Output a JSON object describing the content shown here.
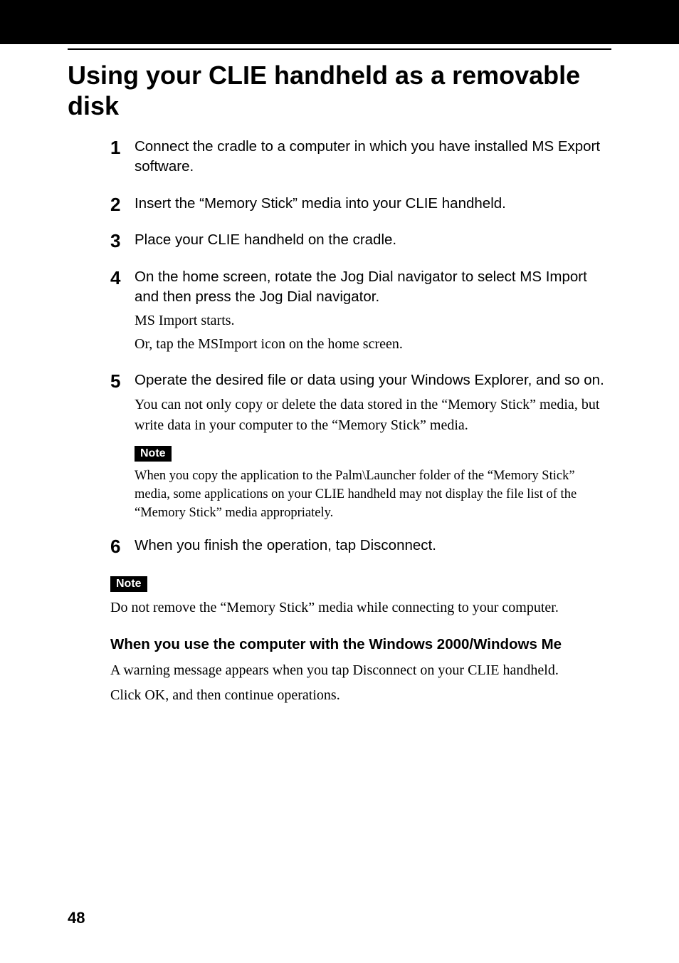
{
  "title": "Using your CLIE handheld as a removable disk",
  "steps": [
    {
      "num": "1",
      "instruction": "Connect the cradle to a computer in which you have installed MS Export software."
    },
    {
      "num": "2",
      "instruction": "Insert the “Memory Stick” media into your CLIE handheld."
    },
    {
      "num": "3",
      "instruction": "Place your CLIE handheld on the cradle."
    },
    {
      "num": "4",
      "instruction": "On the home screen, rotate the Jog Dial navigator to select MS Import and then press the Jog Dial navigator.",
      "subs": [
        "MS Import starts.",
        "Or, tap the MSImport icon on the home screen."
      ]
    },
    {
      "num": "5",
      "instruction": "Operate the desired file or data using your Windows Explorer, and so on.",
      "subs": [
        "You can not only copy or delete the data stored in the “Memory Stick” media, but write data in your computer to the “Memory Stick” media."
      ],
      "note": {
        "label": "Note",
        "text": "When you copy the application to the Palm\\Launcher folder of the “Memory Stick” media, some applications on your CLIE handheld may not display the file list of the “Memory Stick” media appropriately."
      }
    },
    {
      "num": "6",
      "instruction": "When you finish the operation, tap Disconnect."
    }
  ],
  "outer_note": {
    "label": "Note",
    "text": "Do not remove the “Memory Stick” media while connecting to your computer."
  },
  "sub_heading": "When you use the computer with the Windows 2000/Windows Me",
  "sub_paras": [
    "A warning message appears when you tap Disconnect on your CLIE handheld.",
    "Click OK, and then continue operations."
  ],
  "page_num": "48"
}
